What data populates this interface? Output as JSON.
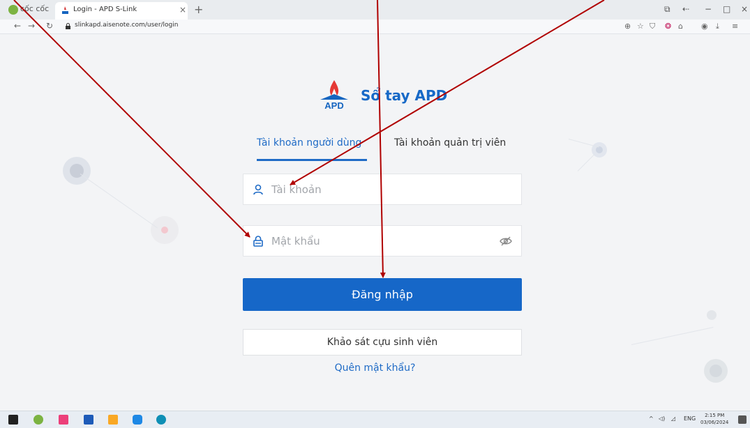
{
  "browser": {
    "brand": "cốc cốc",
    "tab_title": "Login - APD S-Link",
    "tab_close": "×",
    "new_tab": "+",
    "url": "slinkapd.aisenote.com/user/login",
    "window_controls": [
      "−",
      "□",
      "×"
    ]
  },
  "logo": {
    "mark_text": "APD",
    "title": "Sổ tay APD"
  },
  "tabs": {
    "user": "Tài khoản người dùng",
    "admin": "Tài khoản quản trị viên"
  },
  "form": {
    "account_placeholder": "Tài khoản",
    "account_value": "",
    "password_placeholder": "Mật khẩu",
    "password_value": "",
    "login_label": "Đăng nhập",
    "survey_label": "Khảo sát cựu sinh viên",
    "forgot_label": "Quên mật khẩu?"
  },
  "taskbar": {
    "language": "ENG",
    "time": "2:15 PM",
    "date": "03/06/2024"
  },
  "colors": {
    "primary": "#1667c8",
    "arrow": "#b00000"
  },
  "icons": [
    "user-icon",
    "lock-icon",
    "eye-off-icon"
  ]
}
